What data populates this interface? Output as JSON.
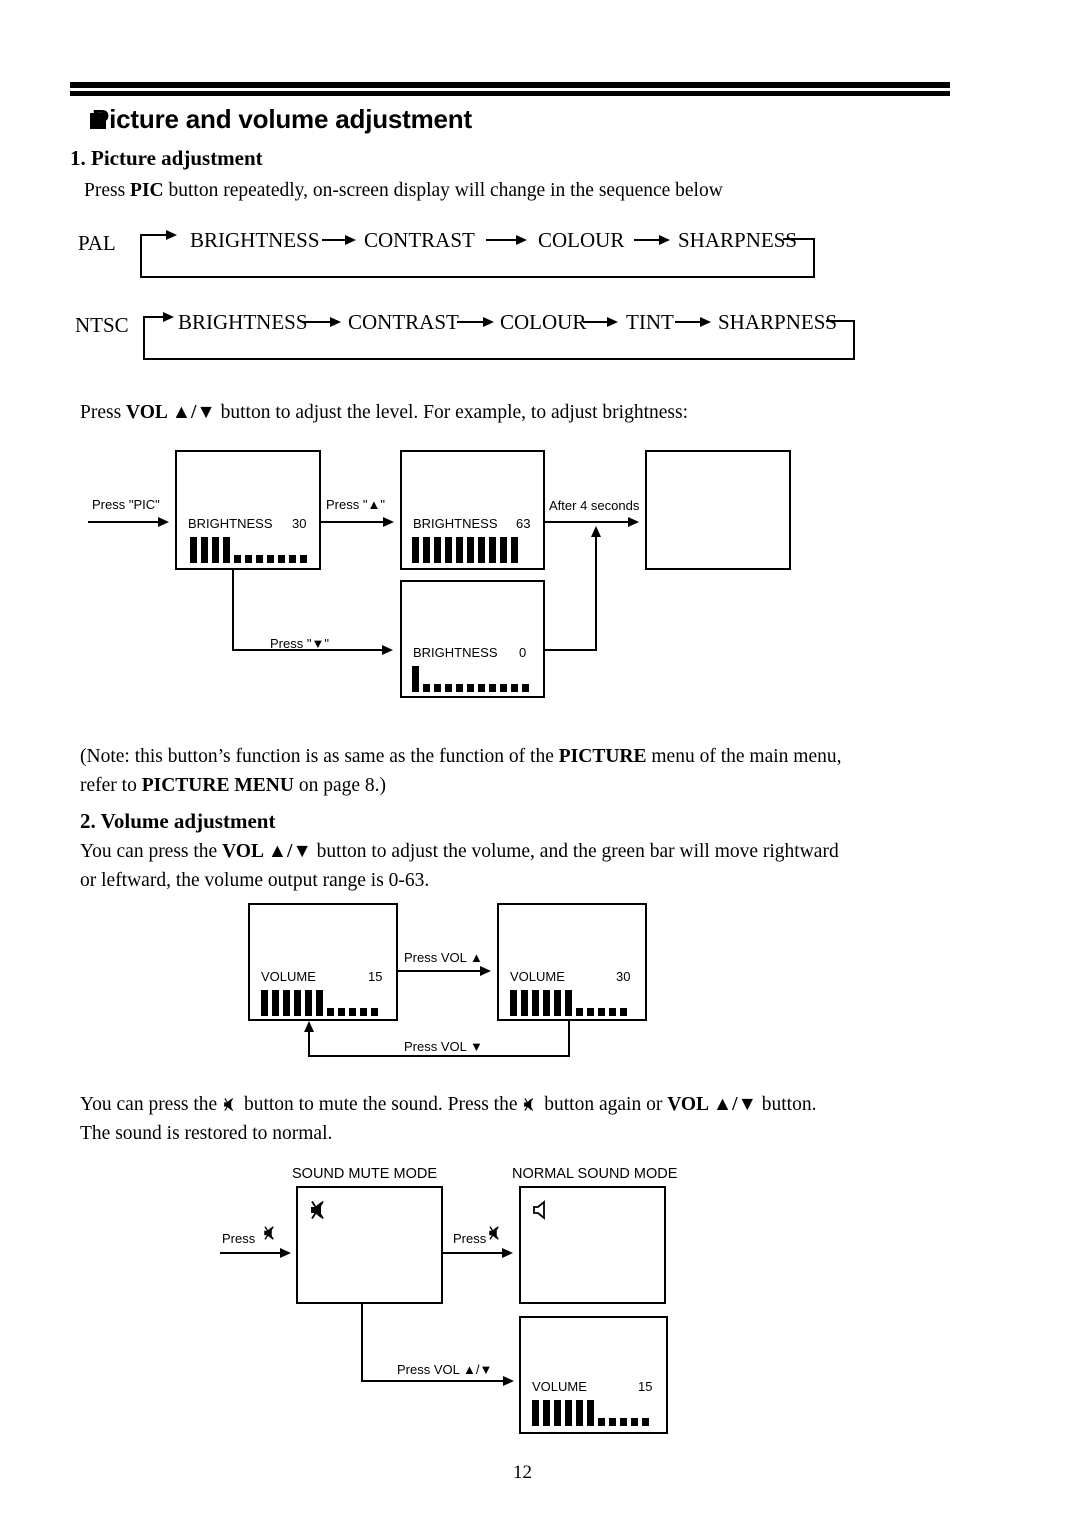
{
  "document": {
    "page_number": "12",
    "title": "Picture and volume adjustment"
  },
  "sections": {
    "picture": {
      "heading": "1. Picture adjustment",
      "intro_pre": "Press ",
      "intro_bold": "PIC",
      "intro_post": " button repeatedly, on-screen display will change in the sequence below",
      "sequences": [
        {
          "label": "PAL",
          "items": [
            "BRIGHTNESS",
            "CONTRAST",
            "COLOUR",
            "SHARPNESS"
          ]
        },
        {
          "label": "NTSC",
          "items": [
            "BRIGHTNESS",
            "CONTRAST",
            "COLOUR",
            "TINT",
            "SHARPNESS"
          ]
        }
      ],
      "level_pre": "Press ",
      "level_bold": "VOL ▲/▼",
      "level_post": " button to adjust the level. For example, to adjust brightness:",
      "flow": {
        "arrow_press_pic": "Press \"PIC\"",
        "arrow_press_up": "Press \"▲\"",
        "arrow_press_down": "Press \"▼\"",
        "arrow_after": "After 4 seconds",
        "screens": [
          {
            "label": "BRIGHTNESS",
            "value": "30",
            "filled": 4,
            "empty": 7
          },
          {
            "label": "BRIGHTNESS",
            "value": "63",
            "filled": 10,
            "empty": 0
          },
          {
            "label": "BRIGHTNESS",
            "value": "0",
            "filled": 1,
            "empty": 10
          },
          {
            "label": "",
            "value": "",
            "filled": 0,
            "empty": 0
          }
        ]
      },
      "note_line1_a": "(Note: this button’s function is as same as the function of the ",
      "note_line1_b": "PICTURE",
      "note_line1_c": " menu of the main menu,",
      "note_line2_a": "refer to ",
      "note_line2_b": "PICTURE MENU",
      "note_line2_c": " on  page 8.)"
    },
    "volume": {
      "heading": "2. Volume adjustment",
      "body_a": "You can press the ",
      "body_b": "VOL ▲/▼",
      "body_c": " button to adjust the volume, and the green bar will move rightward",
      "body_d": "or leftward, the volume output range is 0-63.",
      "flow": {
        "arrow_up": "Press VOL ▲",
        "arrow_down": "Press VOL ▼",
        "screens": [
          {
            "label": "VOLUME",
            "value": "15",
            "filled": 6,
            "empty": 5
          },
          {
            "label": "VOLUME",
            "value": "30",
            "filled": 6,
            "empty": 5
          }
        ]
      }
    },
    "mute": {
      "body_a": "You can press the ",
      "body_icon1": "mute-speaker-icon",
      "body_b": " button to mute the sound. Press the ",
      "body_icon2": "mute-speaker-icon",
      "body_c": " button again or ",
      "body_bold": "VOL ▲/▼",
      "body_d": " button.",
      "body_line2": "The sound is restored to normal.",
      "flow": {
        "caption_mute": "SOUND MUTE MODE",
        "caption_normal": "NORMAL SOUND MODE",
        "arrow_press_1": "Press",
        "arrow_press_2": "Press",
        "arrow_vol": "Press VOL ▲/▼",
        "screens": [
          {
            "icon": "mute-speaker-icon"
          },
          {
            "icon": "speaker-icon"
          },
          {
            "label": "VOLUME",
            "value": "15",
            "filled": 6,
            "empty": 5
          }
        ]
      }
    }
  }
}
